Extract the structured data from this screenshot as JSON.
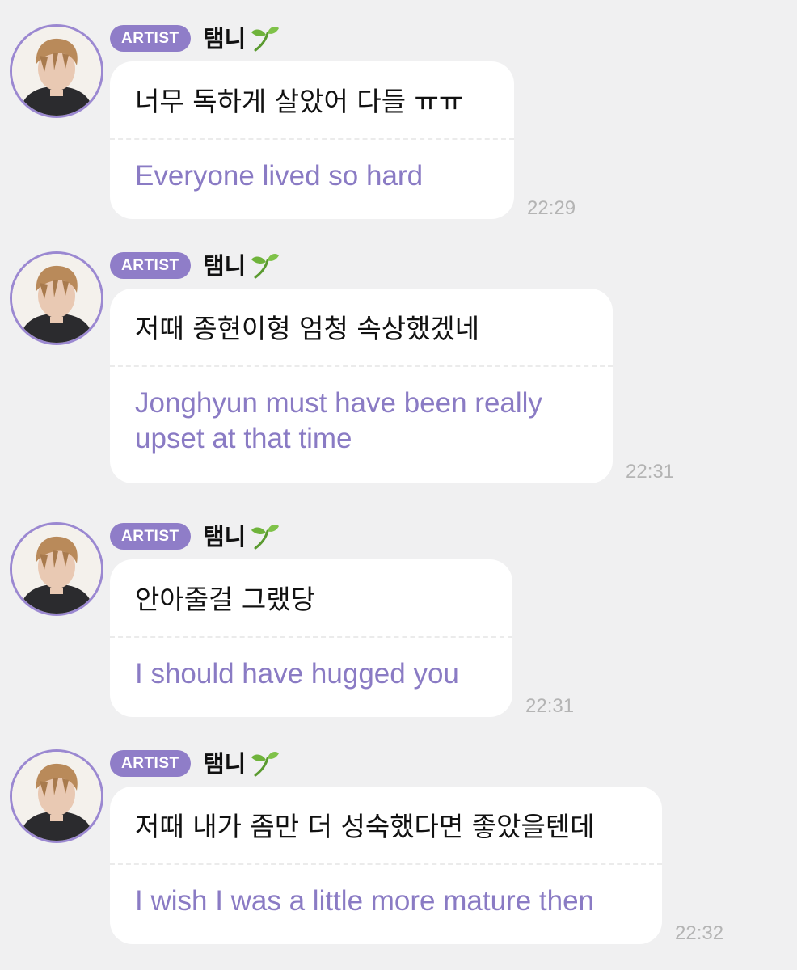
{
  "messages": [
    {
      "badge": "ARTIST",
      "sender": "탬니",
      "korean": "너무 독하게 살았어 다들 ㅠㅠ",
      "translation": "Everyone lived so hard",
      "time": "22:29"
    },
    {
      "badge": "ARTIST",
      "sender": "탬니",
      "korean": "저때 종현이형 엄청 속상했겠네",
      "translation": "Jonghyun must have been really upset at that time",
      "time": "22:31"
    },
    {
      "badge": "ARTIST",
      "sender": "탬니",
      "korean": "안아줄걸 그랬당",
      "translation": "I should have hugged you",
      "time": "22:31"
    },
    {
      "badge": "ARTIST",
      "sender": "탬니",
      "korean": "저때 내가 좀만 더 성숙했다면 좋았을텐데",
      "translation": "I wish I was a little more mature then",
      "time": "22:32"
    }
  ],
  "colors": {
    "background": "#f0f0f1",
    "badge": "#8f7dc8",
    "translation_text": "#8a7bc4",
    "avatar_ring": "#9b88d1",
    "timestamp": "#b4b4b4"
  },
  "icons": {
    "sender_emoji": "sprout-icon",
    "avatar": "avatar-photo"
  }
}
